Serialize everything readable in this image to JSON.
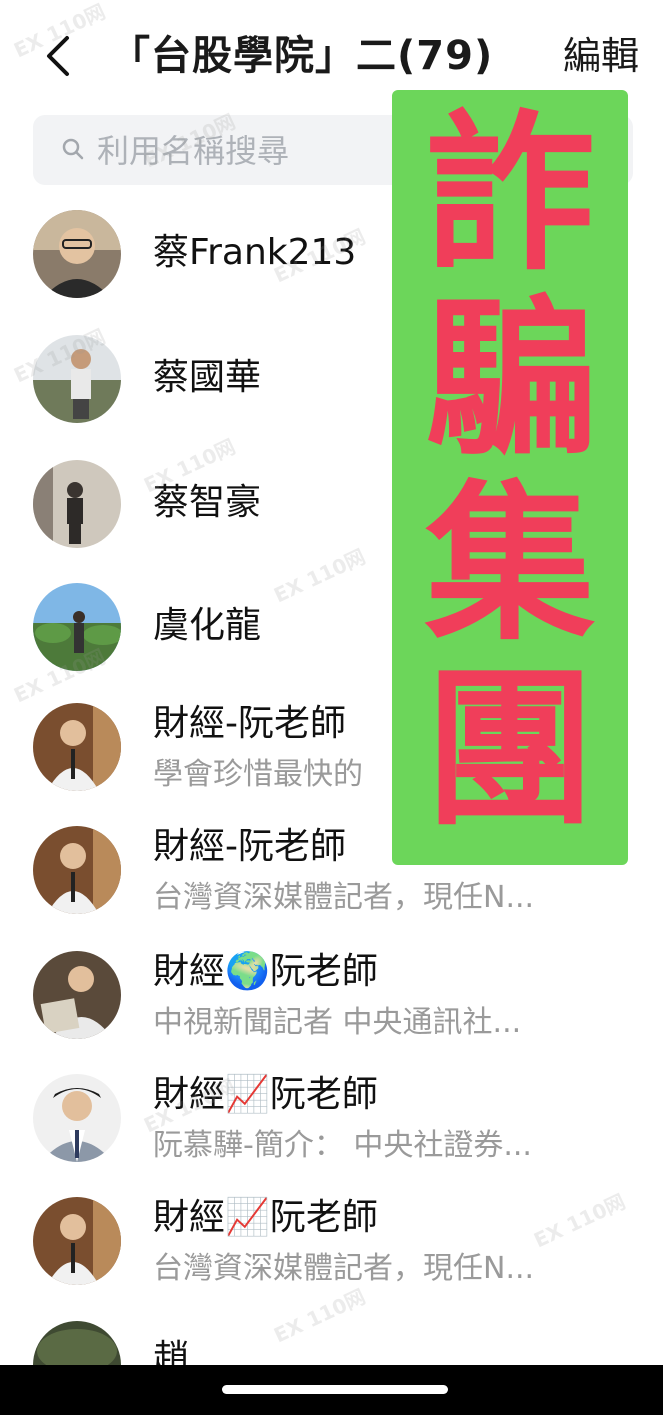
{
  "header": {
    "back_icon": "chevron-left-icon",
    "title": "「台股學院」二(79)",
    "edit_label": "編輯"
  },
  "search": {
    "placeholder": "利用名稱搜尋",
    "icon": "search-icon"
  },
  "members": [
    {
      "name": "蔡Frank213",
      "subtitle": ""
    },
    {
      "name": "蔡國華",
      "subtitle": ""
    },
    {
      "name": "蔡智豪",
      "subtitle": ""
    },
    {
      "name": "虞化龍",
      "subtitle": ""
    },
    {
      "name": "財經-阮老師",
      "subtitle": "學會珍惜最快的"
    },
    {
      "name": "財經-阮老師",
      "subtitle": "台灣資深媒體記者，現任N..."
    },
    {
      "name": "財經🌍阮老師",
      "subtitle": "中視新聞記者  中央通訊社..."
    },
    {
      "name": "財經📈阮老師",
      "subtitle": "阮慕驊-簡介：  中央社證券..."
    },
    {
      "name": "財經📈阮老師",
      "subtitle": "台灣資深媒體記者，現任N..."
    },
    {
      "name": "趙",
      "subtitle": ""
    }
  ],
  "overlay": {
    "chars": [
      "詐",
      "騙",
      "集",
      "團"
    ],
    "background_color": "#6cd65a",
    "text_color": "#f03e5a"
  },
  "watermark": "EX 110网"
}
